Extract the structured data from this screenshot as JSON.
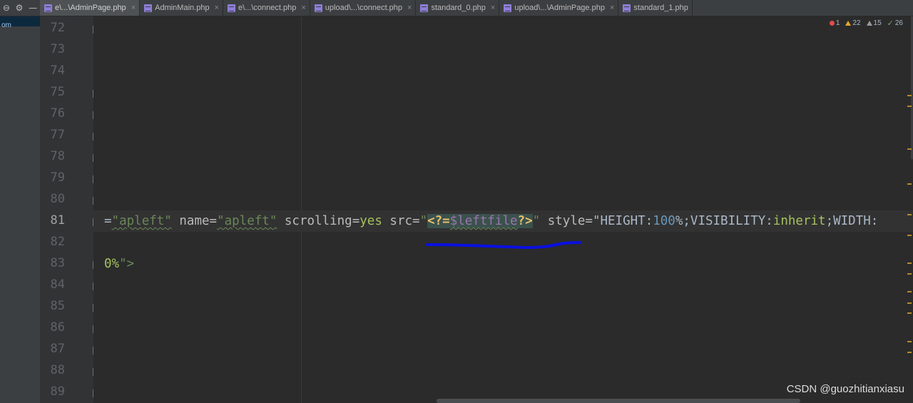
{
  "project_panel": {
    "tools": [
      "⊖",
      "⚙",
      "—"
    ],
    "selected_item": "om"
  },
  "tabs": [
    {
      "label": "e\\...\\AdminPage.php",
      "active": true
    },
    {
      "label": "AdminMain.php",
      "active": false
    },
    {
      "label": "e\\...\\connect.php",
      "active": false
    },
    {
      "label": "upload\\...\\connect.php",
      "active": false
    },
    {
      "label": "standard_0.php",
      "active": false
    },
    {
      "label": "upload\\...\\AdminPage.php",
      "active": false
    },
    {
      "label": "standard_1.php",
      "active": false
    }
  ],
  "tab_close_glyph": "×",
  "inspections": {
    "errors": "1",
    "warnings": "22",
    "weak_warnings": "15",
    "ok": "26"
  },
  "line_numbers": [
    "72",
    "73",
    "74",
    "75",
    "76",
    "77",
    "78",
    "79",
    "80",
    "81",
    "82",
    "83",
    "84",
    "85",
    "86",
    "87",
    "88",
    "89"
  ],
  "current_line": "81",
  "code": {
    "line81": {
      "t1": "=",
      "t2": "\"apleft\"",
      "t3": " name=",
      "t4": "\"apleft\"",
      "t5": " scrolling=",
      "t6": "yes",
      "t7": " src=",
      "t8": "\"",
      "t9": "<?=",
      "t10": "$leftfile",
      "t11": "?>",
      "t12": "\"",
      "t13": " style=",
      "t14": "\"HEIGHT:",
      "t15": "100",
      "t16": "%;VISIBILITY:",
      "t17": "inherit",
      "t18": ";WIDTH:"
    },
    "line83": {
      "t1": "0%",
      "t2": "\">"
    }
  },
  "watermark": "CSDN @guozhitianxiasu",
  "colors": {
    "background": "#2b2b2b",
    "annotation_stroke": "#0a10e0"
  }
}
